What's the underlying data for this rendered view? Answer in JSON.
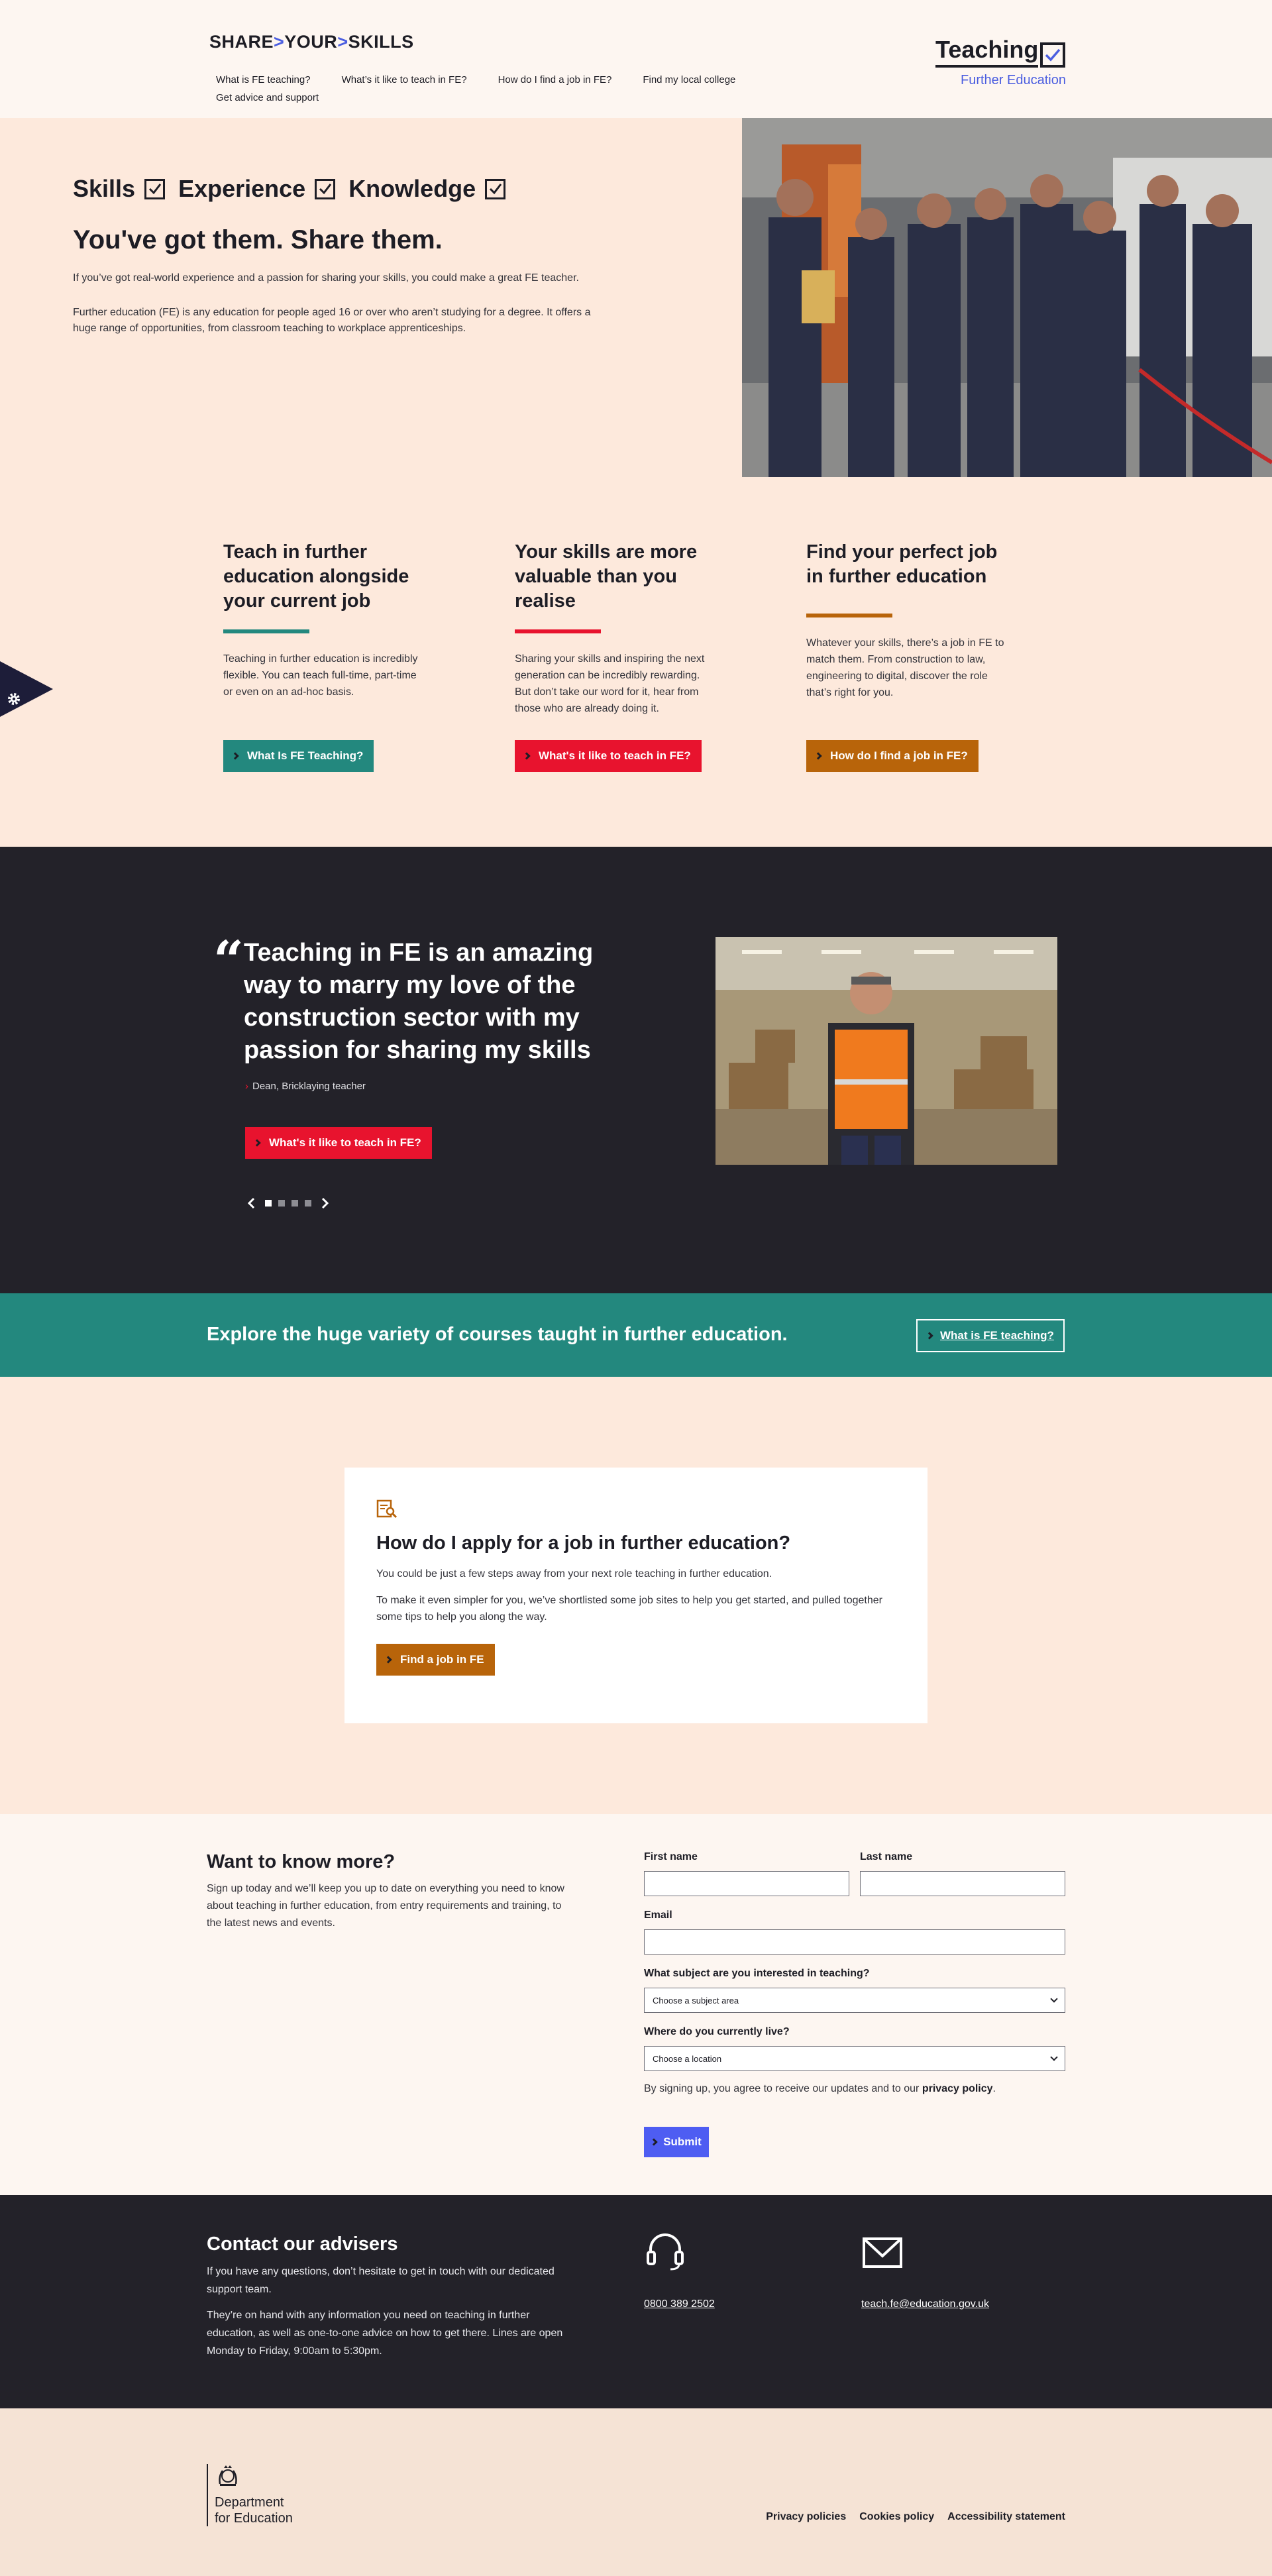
{
  "header": {
    "logo": {
      "part1": "SHARE",
      "part2": "YOUR",
      "part3": "SKILLS"
    },
    "nav": [
      "What is FE teaching?",
      "What’s it like to teach in FE?",
      "How do I find a job in FE?",
      "Find my local college",
      "Get advice and support"
    ],
    "brand_title": "Teaching",
    "brand_subtitle": "Further Education"
  },
  "hero": {
    "skills": [
      "Skills",
      "Experience",
      "Knowledge"
    ],
    "heading": "You've got them. Share them.",
    "para1": "If you’ve got real-world experience and a passion for sharing your skills, you could make a great FE teacher.",
    "para2": "Further education (FE) is any education for people aged 16 or over who aren’t studying for a degree. It offers a huge range of opportunities, from classroom teaching to workplace apprenticeships."
  },
  "columns": [
    {
      "title": "Teach in further education alongside your current job",
      "text": "Teaching in further education is incredibly flexible. You can teach full-time, part-time or even on an ad-hoc basis.",
      "button": "What Is FE Teaching?",
      "color": "#23887e"
    },
    {
      "title": "Your skills are more valuable than you realise",
      "text": "Sharing your skills and inspiring the next generation can be incredibly rewarding. But don’t take our word for it, hear from those who are already doing it.",
      "button": "What's it like to teach in FE?",
      "color": "#e8132e"
    },
    {
      "title": "Find your perfect job in further education",
      "text": "Whatever your skills, there’s a job in FE to match them. From construction to law, engineering to digital, discover the role that’s right for you.",
      "button": "How do I find a job in FE?",
      "color": "#b8640a"
    }
  ],
  "testimonial": {
    "quote": "Teaching in FE is an amazing way to marry my love of the construction sector with my passion for sharing my skills",
    "author": "Dean, Bricklaying teacher",
    "button": "What's it like to teach in FE?",
    "slides": 4,
    "active_slide": 1
  },
  "explore": {
    "text": "Explore the huge variety of courses taught in further education.",
    "button": "What is FE teaching?"
  },
  "apply": {
    "heading": "How do I apply for a job in further education?",
    "para1": "You could be just a few steps away from your next role teaching in further education.",
    "para2": "To make it even simpler for you, we’ve shortlisted some job sites to help you get started, and pulled together some tips to help you along the way.",
    "button": "Find a job in FE"
  },
  "signup": {
    "heading": "Want to know more?",
    "intro": "Sign up today and we’ll keep you up to date on everything you need to know about teaching in further education, from entry requirements and training, to the latest news and events.",
    "first_name_label": "First name",
    "last_name_label": "Last name",
    "email_label": "Email",
    "subject_label": "What subject are you interested in teaching?",
    "subject_value": "Choose a subject area",
    "location_label": "Where do you currently live?",
    "location_value": "Choose a location",
    "agree_text": "By signing up, you agree to receive our updates and to our ",
    "agree_link": "privacy policy",
    "agree_end": ".",
    "submit": "Submit"
  },
  "contact": {
    "heading": "Contact our advisers",
    "para1": "If you have any questions, don’t hesitate to get in touch with our dedicated support team.",
    "para2": "They’re on hand with any information you need on teaching in further education, as well as one-to-one advice on how to get there. Lines are open Monday to Friday, 9:00am to 5:30pm.",
    "phone": "0800 389 2502",
    "email": "teach.fe@education.gov.uk"
  },
  "footer": {
    "dept_line1": "Department",
    "dept_line2": "for Education",
    "links": [
      "Privacy policies",
      "Cookies policy",
      "Accessibility statement"
    ]
  }
}
